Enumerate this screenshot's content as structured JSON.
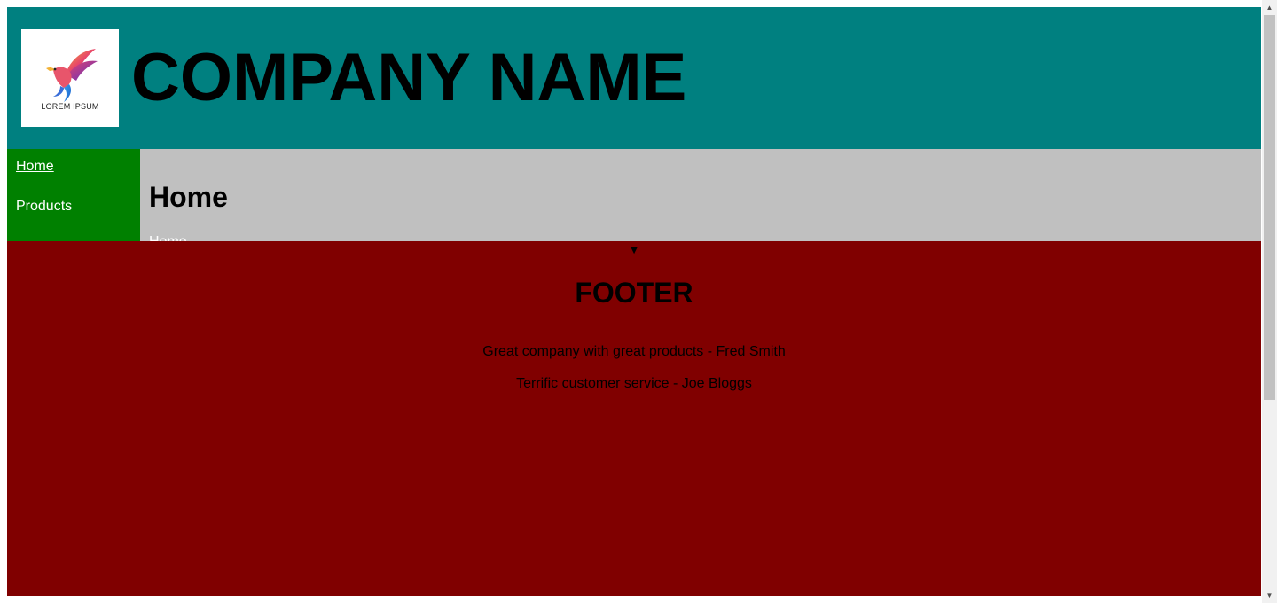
{
  "header": {
    "logo_text": "LOREM IPSUM",
    "company_name": "COMPANY NAME",
    "background_color": "#008080"
  },
  "sidebar": {
    "background_color": "#008000",
    "items": [
      {
        "label": "Home"
      },
      {
        "label": "Products"
      }
    ]
  },
  "main": {
    "title": "Home",
    "subtitle": "Home",
    "background_color": "#c0c0c0"
  },
  "footer": {
    "toggle_icon": "triangle-down-icon",
    "title": "FOOTER",
    "background_color": "#800000",
    "testimonials": [
      "Great company with great products - Fred Smith",
      "Terrific customer service - Joe Bloggs"
    ]
  },
  "scrollbar": {
    "up_icon": "scroll-up-icon",
    "down_icon": "scroll-down-icon"
  }
}
